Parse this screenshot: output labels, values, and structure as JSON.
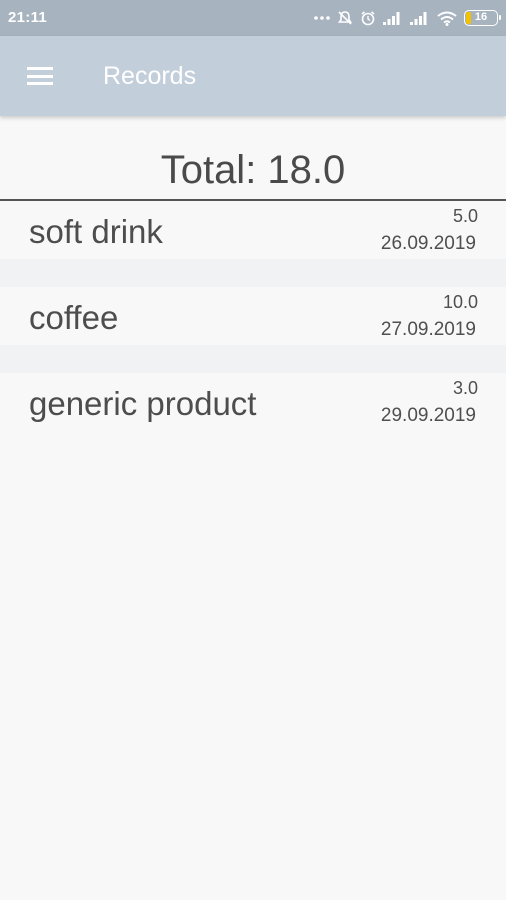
{
  "status_bar": {
    "time": "21:11",
    "battery_level": "16",
    "icons": [
      "more-dots-icon",
      "mute-icon",
      "alarm-icon",
      "signal-icon",
      "signal-icon",
      "wifi-icon",
      "battery-icon"
    ]
  },
  "app_bar": {
    "title": "Records",
    "menu_icon": "hamburger-menu-icon"
  },
  "summary": {
    "total_label": "Total: 18.0"
  },
  "records": [
    {
      "name": "soft drink",
      "amount": "5.0",
      "date": "26.09.2019"
    },
    {
      "name": "coffee",
      "amount": "10.0",
      "date": "27.09.2019"
    },
    {
      "name": "generic product",
      "amount": "3.0",
      "date": "29.09.2019"
    }
  ],
  "colors": {
    "status_bar": "#a8b3c0",
    "app_bar": "#c3cedb",
    "background": "#f8f8f8",
    "text": "#4d4d4d"
  }
}
